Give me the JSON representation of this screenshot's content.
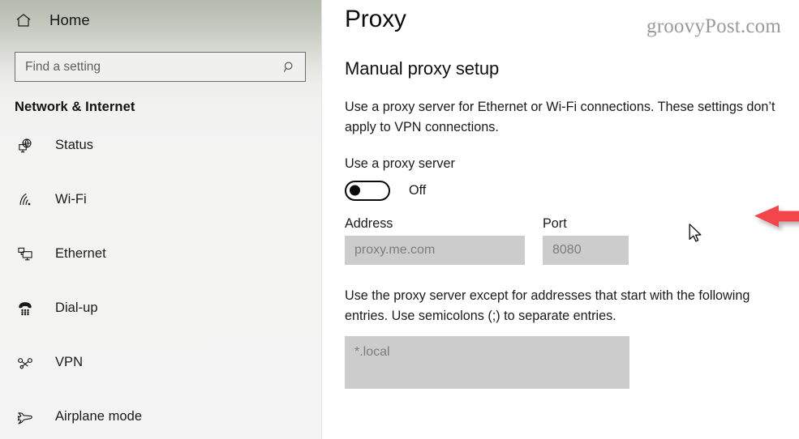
{
  "sidebar": {
    "home": {
      "label": "Home",
      "icon": "home-icon"
    },
    "search": {
      "placeholder": "Find a setting",
      "value": "",
      "icon": "search-icon"
    },
    "section_title": "Network & Internet",
    "items": [
      {
        "label": "Status",
        "icon": "globe-monitor-icon"
      },
      {
        "label": "Wi-Fi",
        "icon": "wifi-icon"
      },
      {
        "label": "Ethernet",
        "icon": "ethernet-icon"
      },
      {
        "label": "Dial-up",
        "icon": "dialup-phone-icon"
      },
      {
        "label": "VPN",
        "icon": "vpn-key-icon"
      },
      {
        "label": "Airplane mode",
        "icon": "airplane-icon"
      }
    ]
  },
  "content": {
    "page_title": "Proxy",
    "watermark": "groovyPost.com",
    "section_heading": "Manual proxy setup",
    "description": "Use a proxy server for Ethernet or Wi-Fi connections. These settings don’t apply to VPN connections.",
    "toggle": {
      "label": "Use a proxy server",
      "state_text": "Off",
      "checked": false
    },
    "address": {
      "label": "Address",
      "placeholder": "proxy.me.com",
      "value": ""
    },
    "port": {
      "label": "Port",
      "placeholder": "8080",
      "value": ""
    },
    "exceptions_description": "Use the proxy server except for addresses that start with the following entries. Use semicolons (;) to separate entries.",
    "exceptions": {
      "placeholder": "*.local",
      "value": ""
    }
  },
  "colors": {
    "arrow_red": "#f4454b",
    "sidebar_top": "#b6bbae",
    "sidebar_bottom": "#f3f3f3",
    "field_disabled_bg": "#cccccc",
    "placeholder_text": "#7d7d7d",
    "watermark_text": "#9a9a9a"
  }
}
